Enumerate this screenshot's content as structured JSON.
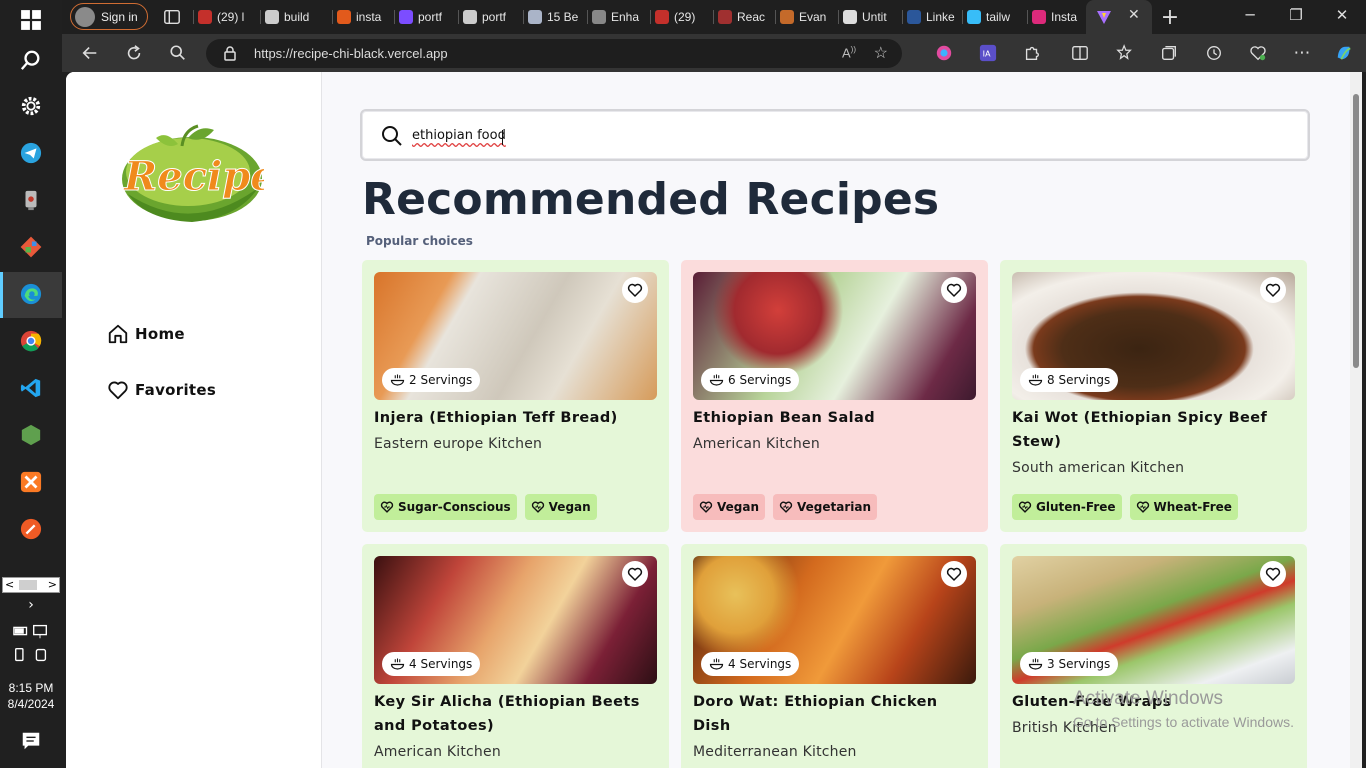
{
  "taskbar": {
    "time": "8:15 PM",
    "date": "8/4/2024"
  },
  "browser": {
    "signin_label": "Sign in",
    "tabs": [
      {
        "label": "(29) l",
        "color": "#c4302b"
      },
      {
        "label": "build",
        "color": "#cccccc"
      },
      {
        "label": "insta",
        "color": "#e25a1c"
      },
      {
        "label": "portf",
        "color": "#7c4dff"
      },
      {
        "label": "portf",
        "color": "#cccccc"
      },
      {
        "label": "15 Be",
        "color": "#aab4c8"
      },
      {
        "label": "Enha",
        "color": "#888888"
      },
      {
        "label": "(29)",
        "color": "#c4302b"
      },
      {
        "label": "Reac",
        "color": "#a03030"
      },
      {
        "label": "Evan",
        "color": "#c46a2a"
      },
      {
        "label": "Untit",
        "color": "#dddddd"
      },
      {
        "label": "Linke",
        "color": "#2b579a"
      },
      {
        "label": "tailw",
        "color": "#38bdf8"
      },
      {
        "label": "Insta",
        "color": "#dd2a7b"
      }
    ],
    "url": "https://recipe-chi-black.vercel.app"
  },
  "sidebar": {
    "logo_text": "Recipe",
    "nav": [
      {
        "label": "Home"
      },
      {
        "label": "Favorites"
      }
    ]
  },
  "search": {
    "value": "ethiopian food"
  },
  "main": {
    "title": "Recommended Recipes",
    "subtitle": "Popular choices"
  },
  "recipes": [
    {
      "name": "Injera (Ethiopian Teff Bread)",
      "kitchen": "Eastern europe Kitchen",
      "servings": "2 Servings",
      "tags": [
        "Sugar-Conscious",
        "Vegan"
      ],
      "theme": "green"
    },
    {
      "name": "Ethiopian Bean Salad",
      "kitchen": "American Kitchen",
      "servings": "6 Servings",
      "tags": [
        "Vegan",
        "Vegetarian"
      ],
      "theme": "pink"
    },
    {
      "name": "Kai Wot (Ethiopian Spicy Beef Stew)",
      "kitchen": "South american Kitchen",
      "servings": "8 Servings",
      "tags": [
        "Gluten-Free",
        "Wheat-Free"
      ],
      "theme": "green"
    },
    {
      "name": "Key Sir Alicha (Ethiopian Beets and Potatoes)",
      "kitchen": "American Kitchen",
      "servings": "4 Servings",
      "tags": [],
      "theme": "green"
    },
    {
      "name": "Doro Wat: Ethiopian Chicken Dish",
      "kitchen": "Mediterranean Kitchen",
      "servings": "4 Servings",
      "tags": [],
      "theme": "green"
    },
    {
      "name": "Gluten-Free Wraps",
      "kitchen": "British Kitchen",
      "servings": "3 Servings",
      "tags": [],
      "theme": "green"
    }
  ],
  "watermark": {
    "line1": "Activate Windows",
    "line2": "Go to Settings to activate Windows."
  }
}
